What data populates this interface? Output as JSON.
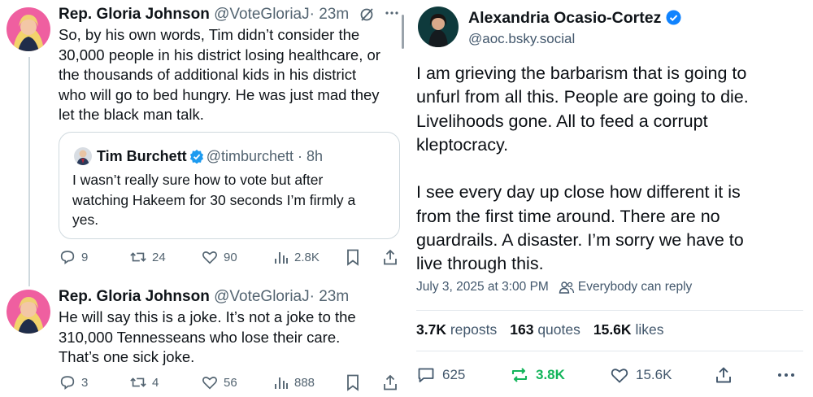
{
  "colors": {
    "accent_blue": "#1d9bf0",
    "bsky_blue": "#1083fe",
    "muted": "#536471",
    "repost_green": "#13b55b"
  },
  "left": {
    "tweets": [
      {
        "name": "Rep. Gloria Johnson",
        "handle": "@VoteGloriaJ",
        "time": "· 23m",
        "text": "So, by his own words, Tim didn’t consider the\n30,000 people in his district losing healthcare, or\nthe thousands of additional kids in his district\nwho will go to bed hungry. He was just mad they\nlet the black man talk.",
        "quote": {
          "name": "Tim Burchett",
          "handle": "@timburchett · 8h",
          "text": "I wasn’t really sure how to vote but after\nwatching Hakeem for 30 seconds I’m firmly a\nyes."
        },
        "actions": {
          "replies": "9",
          "reposts": "24",
          "likes": "90",
          "views": "2.8K"
        }
      },
      {
        "name": "Rep. Gloria Johnson",
        "handle": "@VoteGloriaJ",
        "time": "· 23m",
        "text": "He will say this is a joke. It’s not a joke to the\n310,000 Tennesseans who lose their care.\nThat’s one sick joke.",
        "actions": {
          "replies": "3",
          "reposts": "4",
          "likes": "56",
          "views": "888"
        }
      }
    ]
  },
  "right": {
    "name": "Alexandria Ocasio-Cortez",
    "handle": "@aoc.bsky.social",
    "text": "I am grieving the barbarism that is going to\nunfurl from all this. People are going to die.\nLivelihoods gone. All to feed a corrupt\nkleptocracy.\n\nI see every day up close how different it is\nfrom the first time around. There are no\nguardrails. A disaster. I’m sorry we have to\nlive through this.",
    "date": "July 3, 2025 at 3:00 PM",
    "reply_setting": "Everybody can reply",
    "stats": {
      "reposts_count": "3.7K",
      "reposts_label": "reposts",
      "quotes_count": "163",
      "quotes_label": "quotes",
      "likes_count": "15.6K",
      "likes_label": "likes"
    },
    "actions": {
      "replies": "625",
      "reposts": "3.8K",
      "likes": "15.6K"
    }
  }
}
